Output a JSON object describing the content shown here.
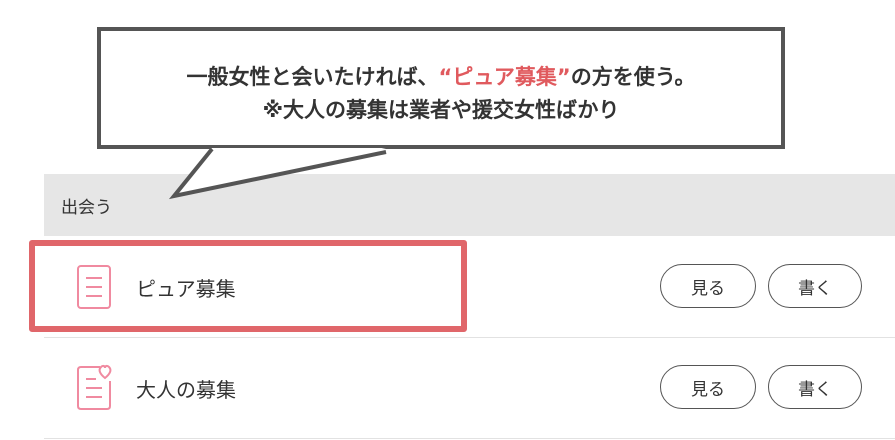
{
  "callout": {
    "line1_prefix": "一般女性と会いたければ、",
    "line1_highlight": "“ピュア募集”",
    "line1_suffix": "の方を使う。",
    "line2": "※大人の募集は業者や援交女性ばかり",
    "highlight_color": "#e05a5e"
  },
  "section": {
    "title": "出会う"
  },
  "rows": [
    {
      "label": "ピュア募集",
      "icon": "document-lines-icon",
      "view_label": "見る",
      "write_label": "書く",
      "highlighted": true
    },
    {
      "label": "大人の募集",
      "icon": "document-heart-icon",
      "view_label": "見る",
      "write_label": "書く",
      "highlighted": false
    }
  ],
  "colors": {
    "accent": "#e0666a",
    "icon": "#f08aa0",
    "header_bg": "#e6e6e6",
    "bubble_border": "#555555"
  }
}
